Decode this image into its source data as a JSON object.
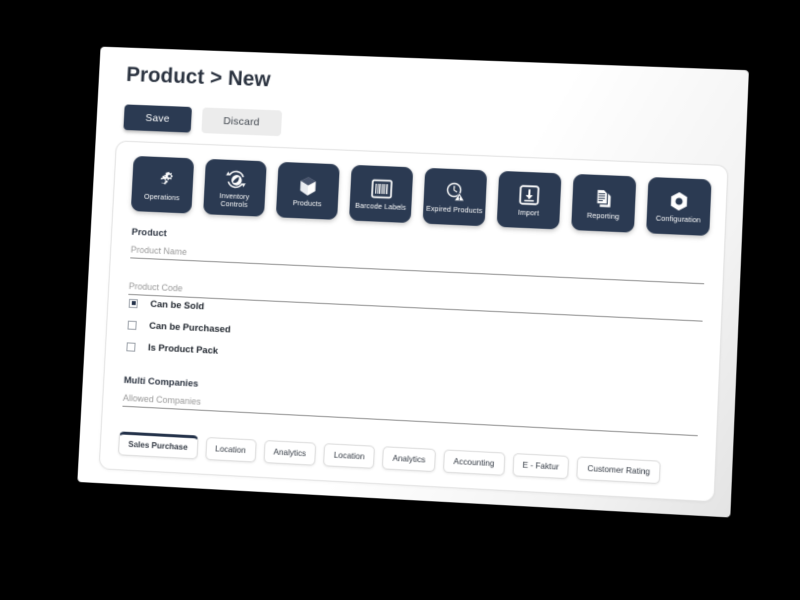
{
  "header": {
    "title": "Product > New",
    "save_label": "Save",
    "discard_label": "Discard"
  },
  "theme": {
    "accent": "#2b3a52",
    "page_background": "#000000",
    "card_background": "#ffffff",
    "text_color": "#2b3340",
    "placeholder_color": "#9a9a9a"
  },
  "tiles": [
    {
      "label": "Operations",
      "icon": "gears-icon"
    },
    {
      "label": "Inventory Controls",
      "icon": "refresh-circle-icon"
    },
    {
      "label": "Products",
      "icon": "cube-box-icon"
    },
    {
      "label": "Barcode Labels",
      "icon": "barcode-icon"
    },
    {
      "label": "Expired Products",
      "icon": "clock-warning-icon"
    },
    {
      "label": "Import",
      "icon": "import-download-icon"
    },
    {
      "label": "Reporting",
      "icon": "documents-stack-icon"
    },
    {
      "label": "Configuration",
      "icon": "hex-nut-icon"
    }
  ],
  "form": {
    "product_section_label": "Product",
    "product_name": {
      "placeholder": "Product Name",
      "value": ""
    },
    "product_code": {
      "placeholder": "Product Code",
      "value": ""
    },
    "checkboxes": [
      {
        "label": "Can be Sold",
        "checked": true
      },
      {
        "label": "Can be Purchased",
        "checked": false
      },
      {
        "label": "Is Product Pack",
        "checked": false
      }
    ],
    "multi_companies_label": "Multi Companies",
    "allowed_companies": {
      "placeholder": "Allowed Companies",
      "value": ""
    }
  },
  "tabs": [
    {
      "label": "Sales Purchase",
      "active": true
    },
    {
      "label": "Location",
      "active": false
    },
    {
      "label": "Analytics",
      "active": false
    },
    {
      "label": "Location",
      "active": false
    },
    {
      "label": "Analytics",
      "active": false
    },
    {
      "label": "Accounting",
      "active": false
    },
    {
      "label": "E - Faktur",
      "active": false
    },
    {
      "label": "Customer Rating",
      "active": false
    }
  ]
}
